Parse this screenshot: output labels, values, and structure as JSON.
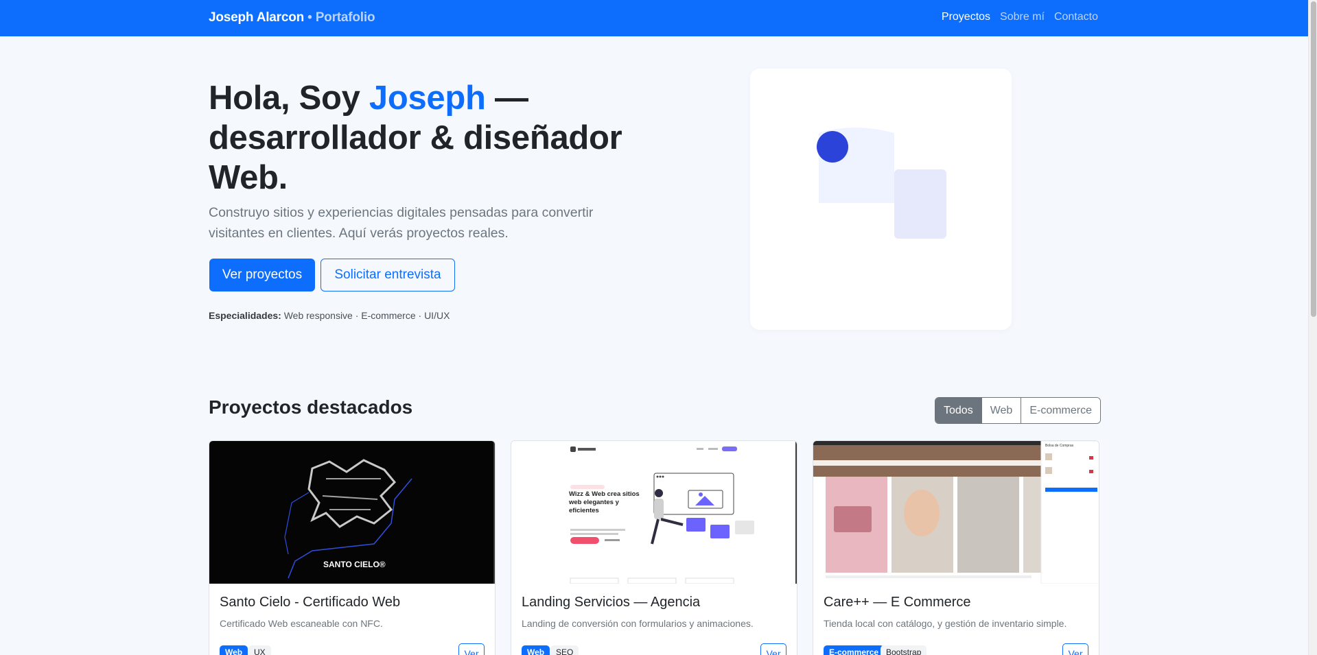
{
  "nav": {
    "brand_name": "Joseph Alarcon",
    "brand_separator": "•",
    "brand_sub": "Portafolio",
    "links": [
      "Proyectos",
      "Sobre mí",
      "Contacto"
    ]
  },
  "hero": {
    "title_pre": "Hola, Soy ",
    "title_name": "Joseph",
    "title_post": " — desarrollador & diseñador Web.",
    "lead": "Construyo sitios y experiencias digitales pensadas para convertir visitantes en clientes. Aquí verás proyectos reales.",
    "btn_primary": "Ver proyectos",
    "btn_secondary": "Solicitar entrevista",
    "specialties_label": "Especialidades:",
    "specialties_value": " Web responsive · E-commerce · UI/UX"
  },
  "projects": {
    "title": "Proyectos destacados",
    "filters": [
      "Todos",
      "Web",
      "E-commerce"
    ],
    "active_filter": "Todos",
    "cards": [
      {
        "title": "Santo Cielo - Certificado Web",
        "text": "Certificado Web escaneable con NFC.",
        "tags": [
          "Web",
          "UX"
        ],
        "button": "Ver",
        "image_caption": "SANTO CIELO®"
      },
      {
        "title": "Landing Servicios — Agencia",
        "text": "Landing de conversión con formularios y animaciones.",
        "tags": [
          "Web",
          "SEO"
        ],
        "button": "Ver",
        "image_caption": "Wizz & Web crea sitios web elegantes y eficientes"
      },
      {
        "title": "Care++ — E Commerce",
        "text": "Tienda local con catálogo, y gestión de inventario simple.",
        "tags": [
          "E-commerce",
          "Bootstrap"
        ],
        "button": "Ver",
        "image_caption": "Bolsa de Compras"
      }
    ]
  },
  "colors": {
    "primary": "#0d6efd",
    "page_bg": "#f5f9fe",
    "secondary": "#6c757d"
  }
}
